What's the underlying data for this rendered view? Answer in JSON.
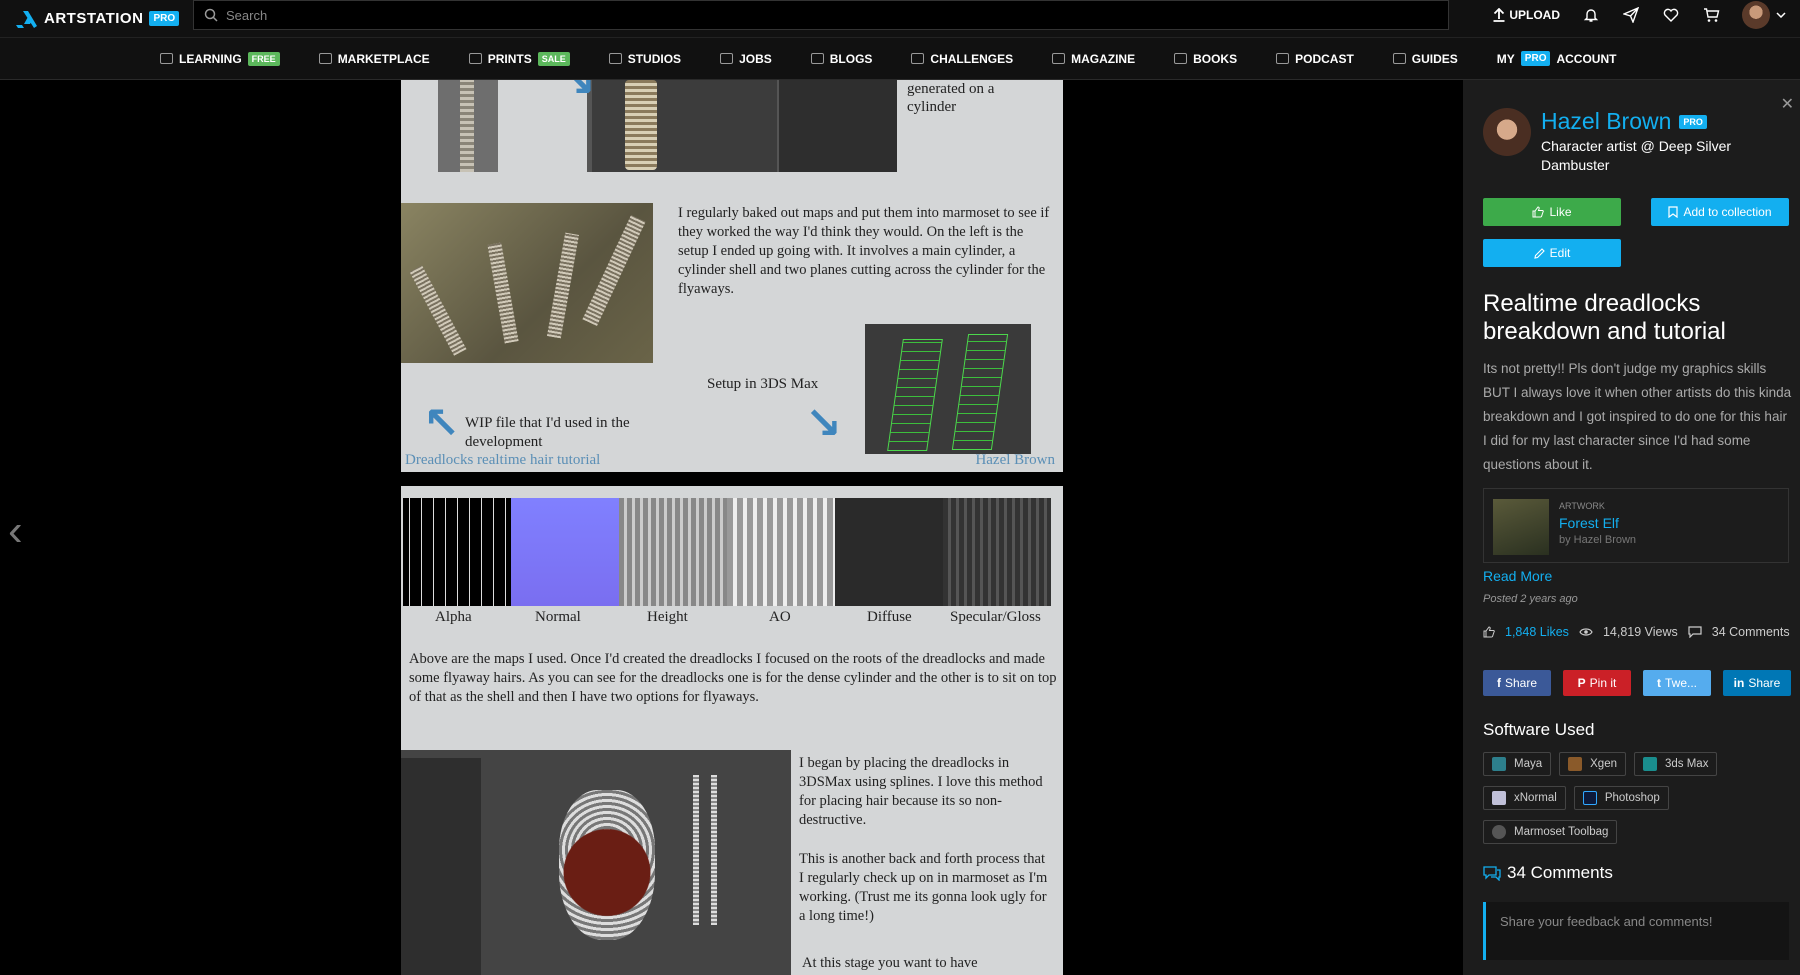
{
  "topbar": {
    "logo_text": "ARTSTATION",
    "logo_badge": "PRO",
    "search_placeholder": "Search",
    "upload_label": "UPLOAD"
  },
  "nav": [
    {
      "label": "LEARNING",
      "tag": "FREE"
    },
    {
      "label": "MARKETPLACE"
    },
    {
      "label": "PRINTS",
      "tag": "SALE"
    },
    {
      "label": "STUDIOS"
    },
    {
      "label": "JOBS"
    },
    {
      "label": "BLOGS"
    },
    {
      "label": "CHALLENGES"
    },
    {
      "label": "MAGAZINE"
    },
    {
      "label": "BOOKS"
    },
    {
      "label": "PODCAST"
    },
    {
      "label": "GUIDES"
    },
    {
      "label": "MY",
      "badge": "PRO",
      "label2": "ACCOUNT"
    }
  ],
  "panel1": {
    "cylinder_text": "generated on a cylinder",
    "paragraph": "I regularly baked out maps and put them into marmoset to see if they worked the way I'd think they would. On the left is the setup I ended up going with. It involves a main cylinder, a cylinder shell and two planes cutting across the cylinder for the flyaways.",
    "setup_caption": "Setup in 3DS Max",
    "wip_caption": "WIP file that I'd used in the development",
    "footer_left": "Dreadlocks realtime hair tutorial",
    "footer_right": "Hazel Brown"
  },
  "panel2": {
    "maps": [
      "Alpha",
      "Normal",
      "Height",
      "AO",
      "Diffuse",
      "Specular/Gloss"
    ],
    "paragraph1": "Above are the maps I used. Once I'd created the dreadlocks I focused on the roots of the dreadlocks and made some flyaway hairs. As you can see for the dreadlocks one is for the dense cylinder and the other is to sit on top of that as the shell and then I have two options for flyaways.",
    "paragraph2": "I began by placing the dreadlocks in 3DSMax using splines. I love this method for placing hair because its so non-destructive.",
    "paragraph3": "This is another back and forth process that I regularly check up on in marmoset as I'm working. (Trust me its gonna look ugly for a long time!)",
    "paragraph4": "At this stage you want to have"
  },
  "sidebar": {
    "author_name": "Hazel Brown",
    "author_badge": "PRO",
    "author_role": "Character artist @ Deep Silver Dambuster",
    "like_label": "Like",
    "collection_label": "Add to collection",
    "edit_label": "Edit",
    "title": "Realtime dreadlocks breakdown and tutorial",
    "description": "Its not pretty!! Pls don't judge my graphics skills BUT I always love it when other artists do this kinda breakdown and I got inspired to do one for this hair I did for my last character since I'd had some questions about it.",
    "artwork_kicker": "ARTWORK",
    "artwork_title": "Forest Elf",
    "artwork_by": "by Hazel Brown",
    "read_more": "Read More",
    "posted": "Posted 2 years ago",
    "likes": "1,848 Likes",
    "views": "14,819 Views",
    "comments_count": "34 Comments",
    "share": [
      "Share",
      "Pin it",
      "Twe...",
      "Share"
    ],
    "software_title": "Software Used",
    "software": [
      "Maya",
      "Xgen",
      "3ds Max",
      "xNormal",
      "Photoshop",
      "Marmoset Toolbag"
    ],
    "comments_title": "34 Comments",
    "comment_placeholder": "Share your feedback and comments!"
  }
}
